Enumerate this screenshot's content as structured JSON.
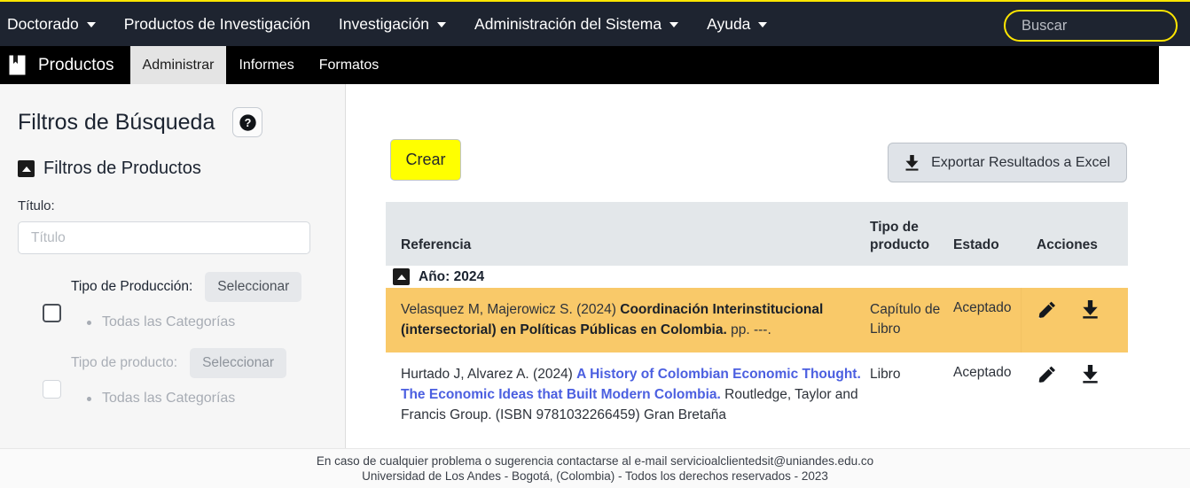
{
  "topnav": {
    "items": [
      {
        "label": "Doctorado",
        "has_caret": true
      },
      {
        "label": "Productos de Investigación",
        "has_caret": false
      },
      {
        "label": "Investigación",
        "has_caret": true
      },
      {
        "label": "Administración del Sistema",
        "has_caret": true
      },
      {
        "label": "Ayuda",
        "has_caret": true
      }
    ],
    "search": {
      "value": "",
      "placeholder": "Buscar",
      "icon": "search-icon"
    }
  },
  "subnav": {
    "brand": "Productos",
    "brand_icon": "book-bookmark-icon",
    "tabs": [
      {
        "label": "Administrar",
        "active": true
      },
      {
        "label": "Informes",
        "active": false
      },
      {
        "label": "Formatos",
        "active": false
      }
    ]
  },
  "sidebar": {
    "title": "Filtros de Búsqueda",
    "help_icon": "question-circle-icon",
    "section_label": "Filtros de Productos",
    "section_toggle_icon": "collapse-up-icon",
    "titulo_label": "Título:",
    "titulo_value": "",
    "titulo_placeholder": "Título",
    "filters": [
      {
        "label": "Tipo de Producción:",
        "button": "Seleccionar",
        "category": "Todas las Categorías"
      },
      {
        "label": "Tipo de producto:",
        "button": "Seleccionar",
        "category": "Todas las Categorías"
      }
    ]
  },
  "main": {
    "create_button": "Crear",
    "export_button": "Exportar Resultados a Excel",
    "export_icon": "download-icon",
    "table": {
      "headers": {
        "referencia": "Referencia",
        "tipo_producto_l1": "Tipo de",
        "tipo_producto_l2": "producto",
        "estado": "Estado",
        "acciones": "Acciones"
      },
      "group": {
        "label": "Año: 2024",
        "toggle_icon": "collapse-up-icon"
      },
      "rows": [
        {
          "highlighted": true,
          "ref_prefix": "Velasquez M, Majerowicz S. (2024) ",
          "ref_bold": "Coordinación Interinstitucional (intersectorial) en Políticas Públicas en Colombia.",
          "ref_suffix": " pp. ---.",
          "ref_link": "",
          "ref_tail": "",
          "tipo_producto": "Capítulo de Libro",
          "estado": "Aceptado",
          "edit_icon": "pencil-icon",
          "download_icon": "download-icon"
        },
        {
          "highlighted": false,
          "ref_prefix": "Hurtado J, Alvarez A. (2024) ",
          "ref_bold": "",
          "ref_suffix": "",
          "ref_link": "A History of Colombian Economic Thought. The Economic Ideas that Built Modern Colombia.",
          "ref_tail": " Routledge, Taylor and Francis Group. (ISBN 9781032266459) Gran Bretaña",
          "tipo_producto": "Libro",
          "estado": "Aceptado",
          "edit_icon": "pencil-icon",
          "download_icon": "download-icon"
        }
      ]
    }
  },
  "footer": {
    "line1": "En caso de cualquier problema o sugerencia contactarse al e-mail servicioalclientedsit@uniandes.edu.co",
    "line2": "Universidad de Los Andes - Bogotá, (Colombia) - Todos los derechos reservados - 2023"
  },
  "colors": {
    "topbar": "#1e2430",
    "accent_yellow": "#ffe600",
    "create_yellow": "#ffff00",
    "highlight_row": "#f9c969",
    "link_blue": "#4b5fe0",
    "table_header": "#e3e7ea"
  }
}
